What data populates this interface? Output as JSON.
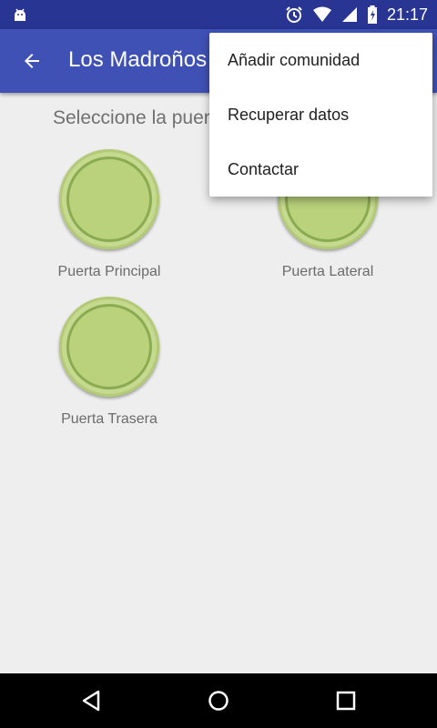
{
  "status_bar": {
    "time": "21:17",
    "icons": [
      "android-debug-icon",
      "alarm-icon",
      "wifi-icon",
      "signal-icon",
      "battery-icon"
    ]
  },
  "app_bar": {
    "title": "Los Madroños",
    "back_icon": "arrow-left-icon"
  },
  "main": {
    "prompt": "Seleccione la puerta",
    "doors": [
      {
        "label": "Puerta Principal"
      },
      {
        "label": "Puerta Lateral"
      },
      {
        "label": "Puerta Trasera"
      }
    ]
  },
  "overflow_menu": {
    "items": [
      {
        "label": "Añadir comunidad"
      },
      {
        "label": "Recuperar datos"
      },
      {
        "label": "Contactar"
      }
    ]
  },
  "nav_bar": {
    "icons": [
      "back-triangle-icon",
      "home-circle-icon",
      "recents-square-icon"
    ]
  },
  "colors": {
    "status_bar": "#283593",
    "app_bar": "#3f51b5",
    "door_button": "#c5d98f",
    "background": "#eeeeee"
  }
}
